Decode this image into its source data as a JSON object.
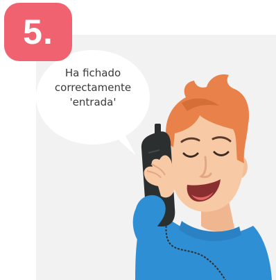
{
  "step": {
    "number": "5."
  },
  "speech_bubble": {
    "lines": [
      "Ha fichado",
      "correctamente",
      "'entrada'"
    ]
  },
  "colors": {
    "badge": "#f0626f",
    "panel_bg": "#f2f2f2",
    "bubble": "#ffffff",
    "hair": "#e8824a",
    "skin": "#f7c9a4",
    "shirt": "#2f8fd4",
    "phone": "#2b2f30"
  },
  "illustration": {
    "subject": "man-on-phone"
  }
}
